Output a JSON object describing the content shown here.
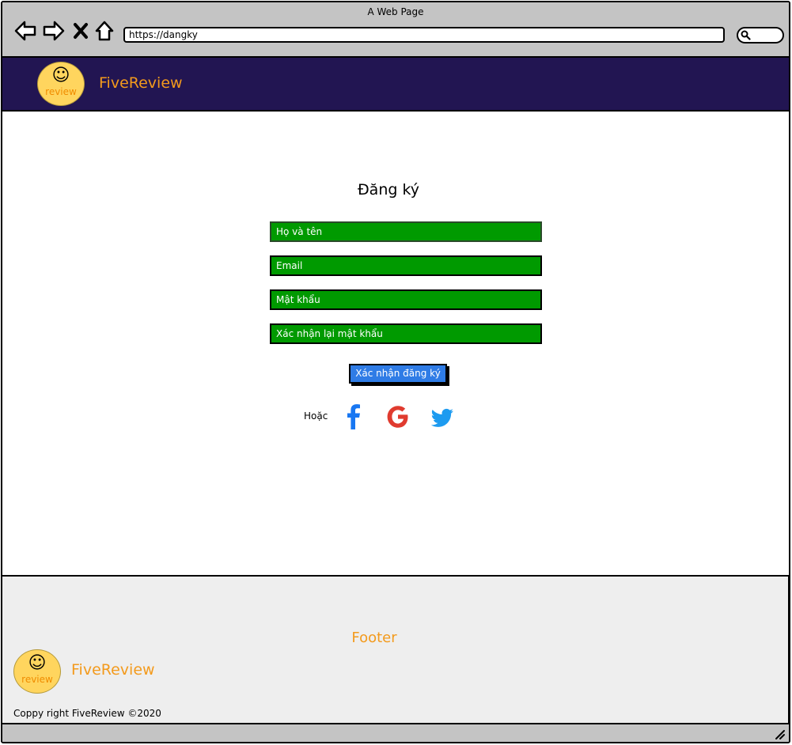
{
  "browser": {
    "window_title": "A Web Page",
    "url": "https://dangky",
    "icons": [
      "back-icon",
      "forward-icon",
      "close-icon",
      "home-icon",
      "search-icon"
    ]
  },
  "header": {
    "logo_text": "review",
    "logo_face": "☺",
    "brand": "FiveReview",
    "background": "#221552",
    "brand_color": "#f39a1c"
  },
  "form": {
    "title": "Đăng ký",
    "fields": {
      "fullname_placeholder": "Họ và tên",
      "email_placeholder": "Email",
      "password_placeholder": "Mật khẩu",
      "confirm_placeholder": "Xác nhận lại mật khẩu"
    },
    "field_color": "#009a00",
    "submit_label": "Xác nhận đăng ký",
    "submit_color": "#2f7ce6",
    "or_label": "Hoặc",
    "social": [
      "facebook-icon",
      "google-icon",
      "twitter-icon"
    ]
  },
  "footer": {
    "title": "Footer",
    "logo_text": "review",
    "logo_face": "☺",
    "brand": "FiveReview",
    "copyright": "Coppy right FiveReview ©2020"
  }
}
